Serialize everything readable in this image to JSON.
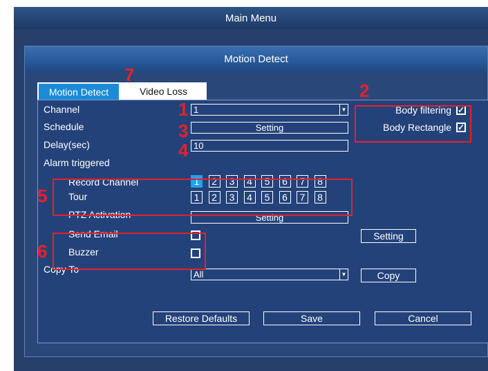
{
  "main_menu": {
    "title": "Main Menu"
  },
  "dialog": {
    "title": "Motion Detect"
  },
  "tabs": [
    {
      "label": "Motion Detect",
      "active": true
    },
    {
      "label": "Video Loss",
      "active": false
    }
  ],
  "form": {
    "channel": {
      "label": "Channel",
      "value": "1"
    },
    "schedule": {
      "label": "Schedule",
      "button": "Setting"
    },
    "delay": {
      "label": "Delay(sec)",
      "value": "10"
    },
    "alarm_triggered": {
      "label": "Alarm triggered"
    },
    "record_channel": {
      "label": "Record Channel",
      "channels": [
        "1",
        "2",
        "3",
        "4",
        "5",
        "6",
        "7",
        "8"
      ],
      "selected": [
        "1"
      ]
    },
    "tour": {
      "label": "Tour",
      "channels": [
        "1",
        "2",
        "3",
        "4",
        "5",
        "6",
        "7",
        "8"
      ]
    },
    "ptz_activation": {
      "label": "PTZ Activation",
      "button": "Setting"
    },
    "send_email": {
      "label": "Send Email",
      "checked": false,
      "button": "Setting"
    },
    "buzzer": {
      "label": "Buzzer",
      "checked": false
    },
    "copy_to": {
      "label": "Copy To",
      "value": "All",
      "button": "Copy"
    },
    "body_filtering": {
      "label": "Body filtering",
      "checked": true
    },
    "body_rectangle": {
      "label": "Body Rectangle",
      "checked": true
    }
  },
  "footer": {
    "restore_defaults": "Restore Defaults",
    "save": "Save",
    "cancel": "Cancel"
  },
  "callouts": [
    "1",
    "2",
    "3",
    "4",
    "5",
    "6",
    "7"
  ],
  "colors": {
    "callout": "#e8202a",
    "selected_channel": "#1ea3e8",
    "active_tab": "#1b8bd6"
  }
}
